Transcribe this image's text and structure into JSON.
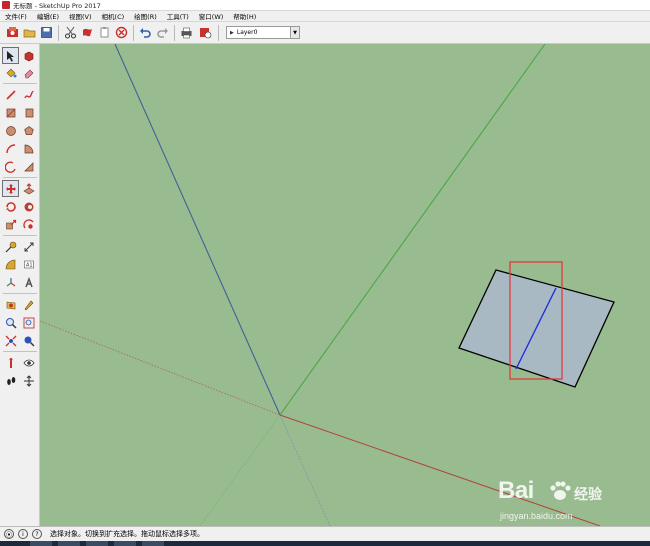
{
  "window": {
    "title": "无标题 - SketchUp Pro 2017"
  },
  "menubar": {
    "items": [
      "文件(F)",
      "编辑(E)",
      "视图(V)",
      "相机(C)",
      "绘图(R)",
      "工具(T)",
      "窗口(W)",
      "帮助(H)"
    ]
  },
  "toolbar": {
    "layer": {
      "current_layer": "Layer0"
    },
    "icons": [
      "get-models-icon",
      "open-icon",
      "save-icon",
      "cut-icon",
      "copy-icon",
      "paste-icon",
      "erase-icon",
      "undo-icon",
      "redo-icon",
      "print-icon",
      "model-info-icon"
    ]
  },
  "left_toolbar": {
    "tools": [
      "select",
      "make-component",
      "paint-bucket",
      "eraser",
      "line",
      "freehand",
      "rectangle",
      "rotated-rectangle",
      "circle",
      "polygon",
      "arc",
      "pie",
      "move",
      "push-pull",
      "rotate",
      "follow-me",
      "scale",
      "offset",
      "tape-measure",
      "dimension",
      "protractor",
      "text",
      "axes",
      "3d-text",
      "section-plane",
      "walk",
      "zoom",
      "zoom-window",
      "zoom-extents",
      "orbit",
      "position-camera",
      "look-around",
      "footprints",
      "walk-through"
    ]
  },
  "viewport": {
    "background": "#98bb8f",
    "axis_colors": {
      "blue": "#3a5b98",
      "green": "#3ea83e",
      "red": "#b0463c"
    },
    "face_color": "#a9b9c3",
    "highlight_rect_color": "#e2393b"
  },
  "statusbar": {
    "text": "选择对象。切换到扩充选择。拖动鼠标选择多项。"
  },
  "watermark": {
    "brand": "Bai",
    "brand_cn": "经验",
    "url": "jingyan.baidu.com"
  }
}
